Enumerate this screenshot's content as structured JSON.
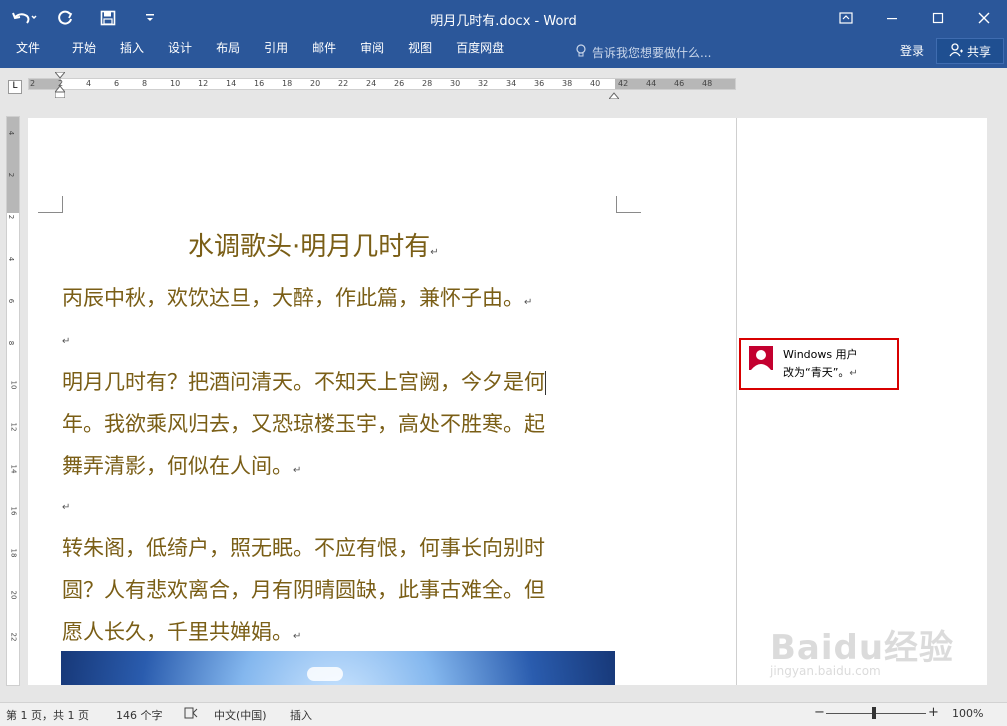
{
  "titlebar": {
    "title": "明月几时有.docx - Word",
    "window_controls": [
      "ribbon-display-icon",
      "minimize-icon",
      "maximize-icon",
      "close-icon"
    ]
  },
  "ribbon": {
    "tabs": [
      "文件",
      "开始",
      "插入",
      "设计",
      "布局",
      "引用",
      "邮件",
      "审阅",
      "视图",
      "百度网盘"
    ],
    "tell_me": "告诉我您想要做什么...",
    "login": "登录",
    "share": "共享"
  },
  "ruler": {
    "h_ticks": [
      "2",
      "2",
      "4",
      "6",
      "8",
      "10",
      "12",
      "14",
      "16",
      "18",
      "20",
      "22",
      "24",
      "26",
      "28",
      "30",
      "32",
      "34",
      "36",
      "38",
      "40",
      "42",
      "44",
      "46",
      "48"
    ],
    "v_ticks": [
      "4",
      "2",
      "2",
      "4",
      "6",
      "8",
      "10",
      "12",
      "14",
      "16",
      "18",
      "20",
      "22"
    ]
  },
  "document": {
    "title": "水调歌头·明月几时有",
    "lines": [
      "丙辰中秋，欢饮达旦，大醉，作此篇，兼怀子由。",
      "",
      "明月几时有？把酒问清天。不知天上宫阙，今夕是何",
      "年。我欲乘风归去，又恐琼楼玉宇，高处不胜寒。起",
      "舞弄清影，何似在人间。",
      "",
      "转朱阁，低绮户，照无眠。不应有恨，何事长向别时",
      "圆？人有悲欢离合，月有阴晴圆缺，此事古难全。但",
      "愿人长久，千里共婵娟。"
    ],
    "para_mark": "↵"
  },
  "comment": {
    "author": "Windows 用户",
    "text": "改为“青天”。"
  },
  "status": {
    "page": "第 1 页，共 1 页",
    "words": "146 个字",
    "language": "中文(中国)",
    "mode": "插入",
    "zoom": "100%"
  },
  "watermark": {
    "brand": "Baidu经验",
    "url": "jingyan.baidu.com"
  }
}
